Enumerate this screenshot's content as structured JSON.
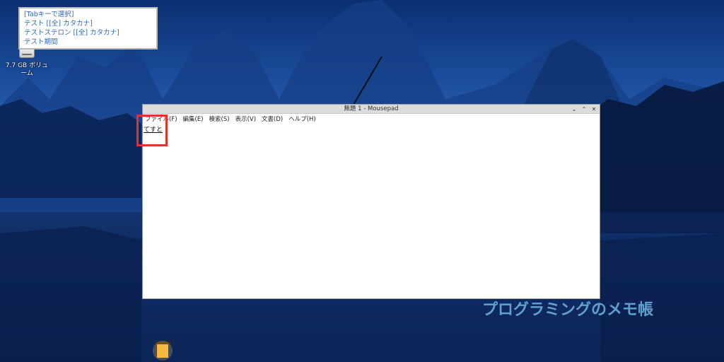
{
  "desktop": {
    "icons": [
      {
        "label": "7.7 GB ボリューム",
        "icon": "drive-icon"
      }
    ],
    "watermark": "プログラミングのメモ帳"
  },
  "ime_popup": {
    "header": "[Tabキーで選択]",
    "candidates": [
      "テスト [[全] カタカナ]",
      "テストステロン [[全] カタカナ]",
      "テスト期間"
    ]
  },
  "window": {
    "title": "無題 1 - Mousepad",
    "controls": [
      "chevron-down-icon",
      "chevron-up-icon",
      "close-icon"
    ],
    "menu": [
      "ファイル(F)",
      "編集(E)",
      "検索(S)",
      "表示(V)",
      "文書(D)",
      "ヘルプ(H)"
    ],
    "editor_text": "てすと"
  },
  "colors": {
    "highlight": "#e2332b",
    "ime_text": "#2f6ab8",
    "watermark": "#6fb7e6"
  }
}
